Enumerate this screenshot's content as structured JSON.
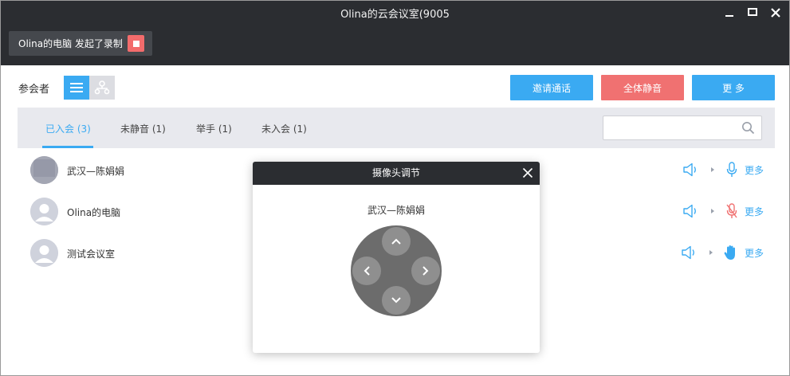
{
  "window": {
    "title": "Olina的云会议室(9005"
  },
  "recording": {
    "label": "Olina的电脑 发起了录制"
  },
  "participants": {
    "title": "参会者",
    "buttons": {
      "invite": "邀请通话",
      "mute_all": "全体静音",
      "more": "更 多"
    },
    "tabs": [
      {
        "label": "已入会 (3)"
      },
      {
        "label": "未静音 (1)"
      },
      {
        "label": "举手 (1)"
      },
      {
        "label": "未入会 (1)"
      }
    ],
    "search": {
      "placeholder": ""
    },
    "rows": [
      {
        "name": "武汉—陈娟娟",
        "more": "更多"
      },
      {
        "name": "Olina的电脑",
        "more": "更多"
      },
      {
        "name": "测试会议室",
        "more": "更多"
      }
    ]
  },
  "camera_dialog": {
    "title": "摄像头调节",
    "participant": "武汉—陈娟娟"
  },
  "colors": {
    "accent": "#3aaaf2",
    "danger": "#f07171",
    "titlebar": "#2b2d31"
  }
}
